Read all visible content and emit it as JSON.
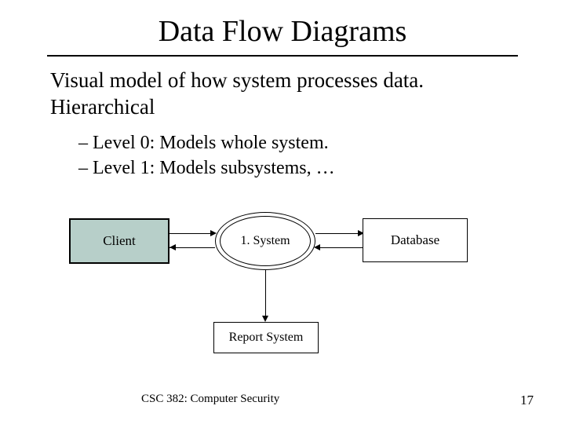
{
  "title": "Data Flow Diagrams",
  "body": {
    "line1": "Visual model of how system processes data.",
    "line2": "Hierarchical"
  },
  "subpoints": {
    "item1": "– Level 0: Models whole system.",
    "item2": "– Level 1: Models subsystems, …"
  },
  "diagram": {
    "client": "Client",
    "system": "1. System",
    "database": "Database",
    "report": "Report System"
  },
  "footer": {
    "course": "CSC 382: Computer Security",
    "page": "17"
  }
}
